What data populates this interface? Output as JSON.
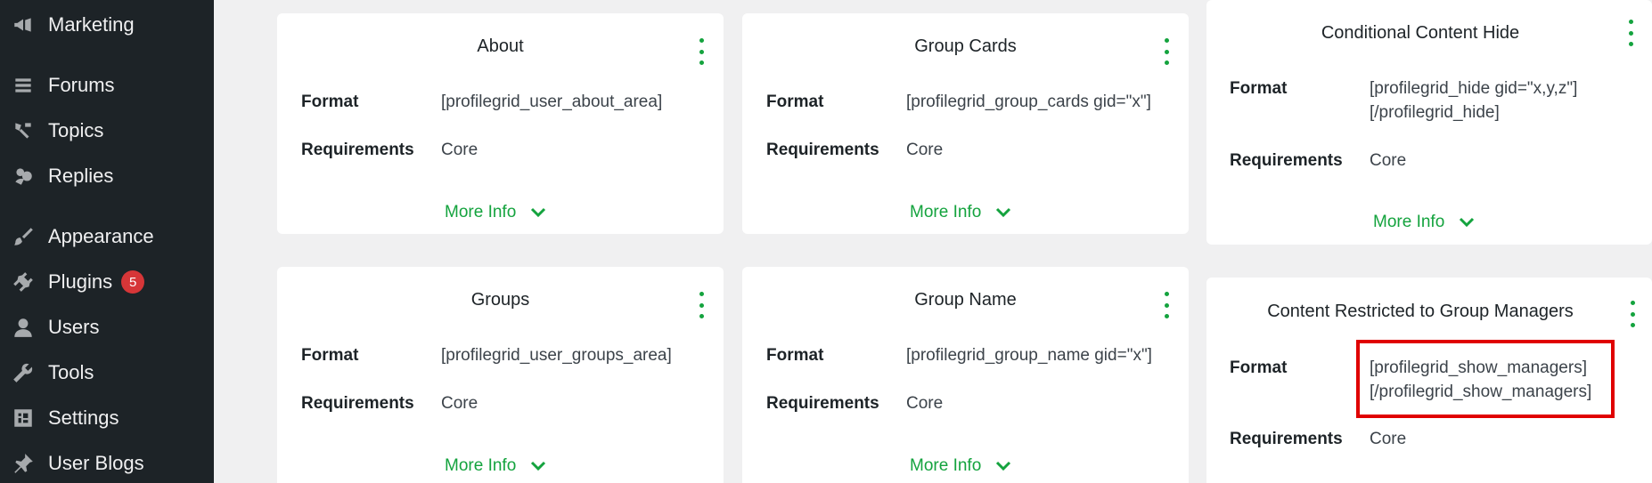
{
  "sidebar": {
    "items": [
      {
        "label": "Marketing",
        "icon": "megaphone-icon"
      },
      {
        "label": "Forums",
        "icon": "forums-icon"
      },
      {
        "label": "Topics",
        "icon": "topics-icon"
      },
      {
        "label": "Replies",
        "icon": "replies-icon"
      },
      {
        "label": "Appearance",
        "icon": "paintbrush-icon"
      },
      {
        "label": "Plugins",
        "icon": "plugin-icon",
        "badge": "5"
      },
      {
        "label": "Users",
        "icon": "user-icon"
      },
      {
        "label": "Tools",
        "icon": "wrench-icon"
      },
      {
        "label": "Settings",
        "icon": "settings-icon"
      },
      {
        "label": "User Blogs",
        "icon": "pin-icon"
      }
    ]
  },
  "labels": {
    "format": "Format",
    "requirements": "Requirements",
    "more_info": "More Info"
  },
  "cards": [
    {
      "title": "About",
      "format": "[profilegrid_user_about_area]",
      "requirements": "Core"
    },
    {
      "title": "Group Cards",
      "format": "[profilegrid_group_cards gid=\"x\"]",
      "requirements": "Core"
    },
    {
      "title": "Conditional Content Hide",
      "format_line1": "[profilegrid_hide gid=\"x,y,z\"]",
      "format_line2": "[/profilegrid_hide]",
      "requirements": "Core"
    },
    {
      "title": "Groups",
      "format": "[profilegrid_user_groups_area]",
      "requirements": "Core"
    },
    {
      "title": "Group Name",
      "format": "[profilegrid_group_name gid=\"x\"]",
      "requirements": "Core"
    },
    {
      "title": "Content Restricted to Group Managers",
      "format_line1": "[profilegrid_show_managers]",
      "format_line2": "[/profilegrid_show_managers]",
      "requirements": "Core"
    }
  ],
  "colors": {
    "accent": "#14a33e",
    "highlight": "#e00000",
    "sidebar_bg": "#1d2327",
    "badge": "#d63638"
  }
}
